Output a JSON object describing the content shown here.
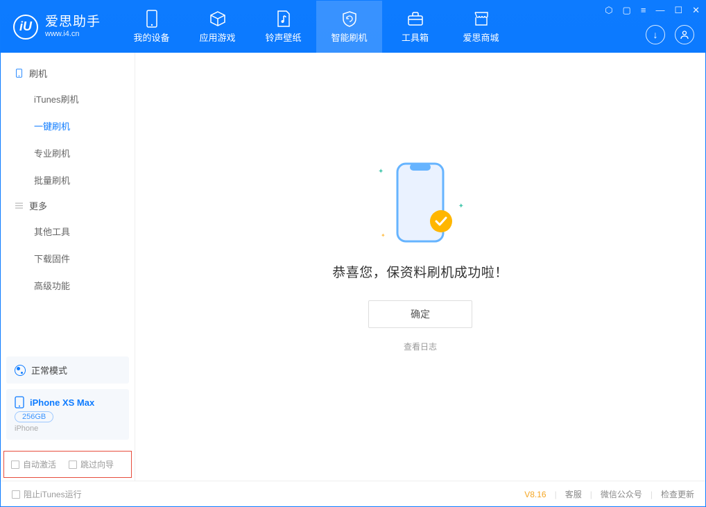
{
  "app": {
    "name": "爱思助手",
    "url": "www.i4.cn"
  },
  "nav": {
    "items": [
      {
        "label": "我的设备"
      },
      {
        "label": "应用游戏"
      },
      {
        "label": "铃声壁纸"
      },
      {
        "label": "智能刷机"
      },
      {
        "label": "工具箱"
      },
      {
        "label": "爱思商城"
      }
    ]
  },
  "sidebar": {
    "group1": "刷机",
    "items1": [
      {
        "label": "iTunes刷机"
      },
      {
        "label": "一键刷机"
      },
      {
        "label": "专业刷机"
      },
      {
        "label": "批量刷机"
      }
    ],
    "group2": "更多",
    "items2": [
      {
        "label": "其他工具"
      },
      {
        "label": "下载固件"
      },
      {
        "label": "高级功能"
      }
    ],
    "mode": "正常模式",
    "device": {
      "name": "iPhone XS Max",
      "capacity": "256GB",
      "type": "iPhone"
    },
    "opts": {
      "auto_activate": "自动激活",
      "skip_guide": "跳过向导"
    }
  },
  "main": {
    "success": "恭喜您，保资料刷机成功啦！",
    "ok": "确定",
    "log": "查看日志"
  },
  "footer": {
    "block_itunes": "阻止iTunes运行",
    "version": "V8.16",
    "support": "客服",
    "wechat": "微信公众号",
    "update": "检查更新"
  }
}
